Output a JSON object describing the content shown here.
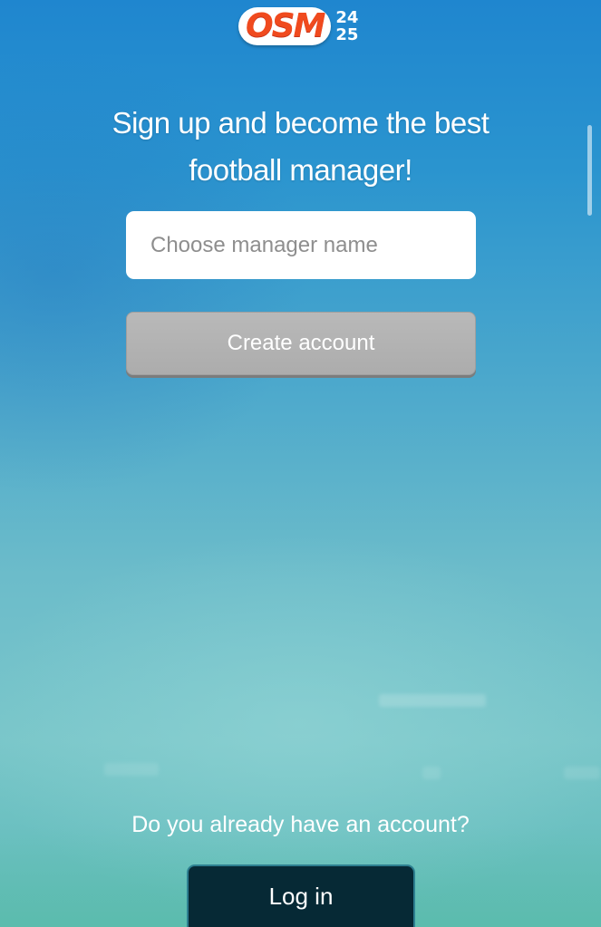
{
  "logo": {
    "brand": "OSM",
    "year_top": "24",
    "year_bottom": "25",
    "brand_color": "#f04a1e"
  },
  "signup": {
    "headline_line1": "Sign up and become the best",
    "headline_line2": "football manager!",
    "name_placeholder": "Choose manager name",
    "name_value": "",
    "create_button_label": "Create account"
  },
  "login": {
    "question": "Do you already have an account?",
    "button_label": "Log in"
  },
  "colors": {
    "create_button_disabled": "#b3b3b3",
    "login_button_bg": "#062935",
    "login_button_border": "#2d7f90"
  }
}
